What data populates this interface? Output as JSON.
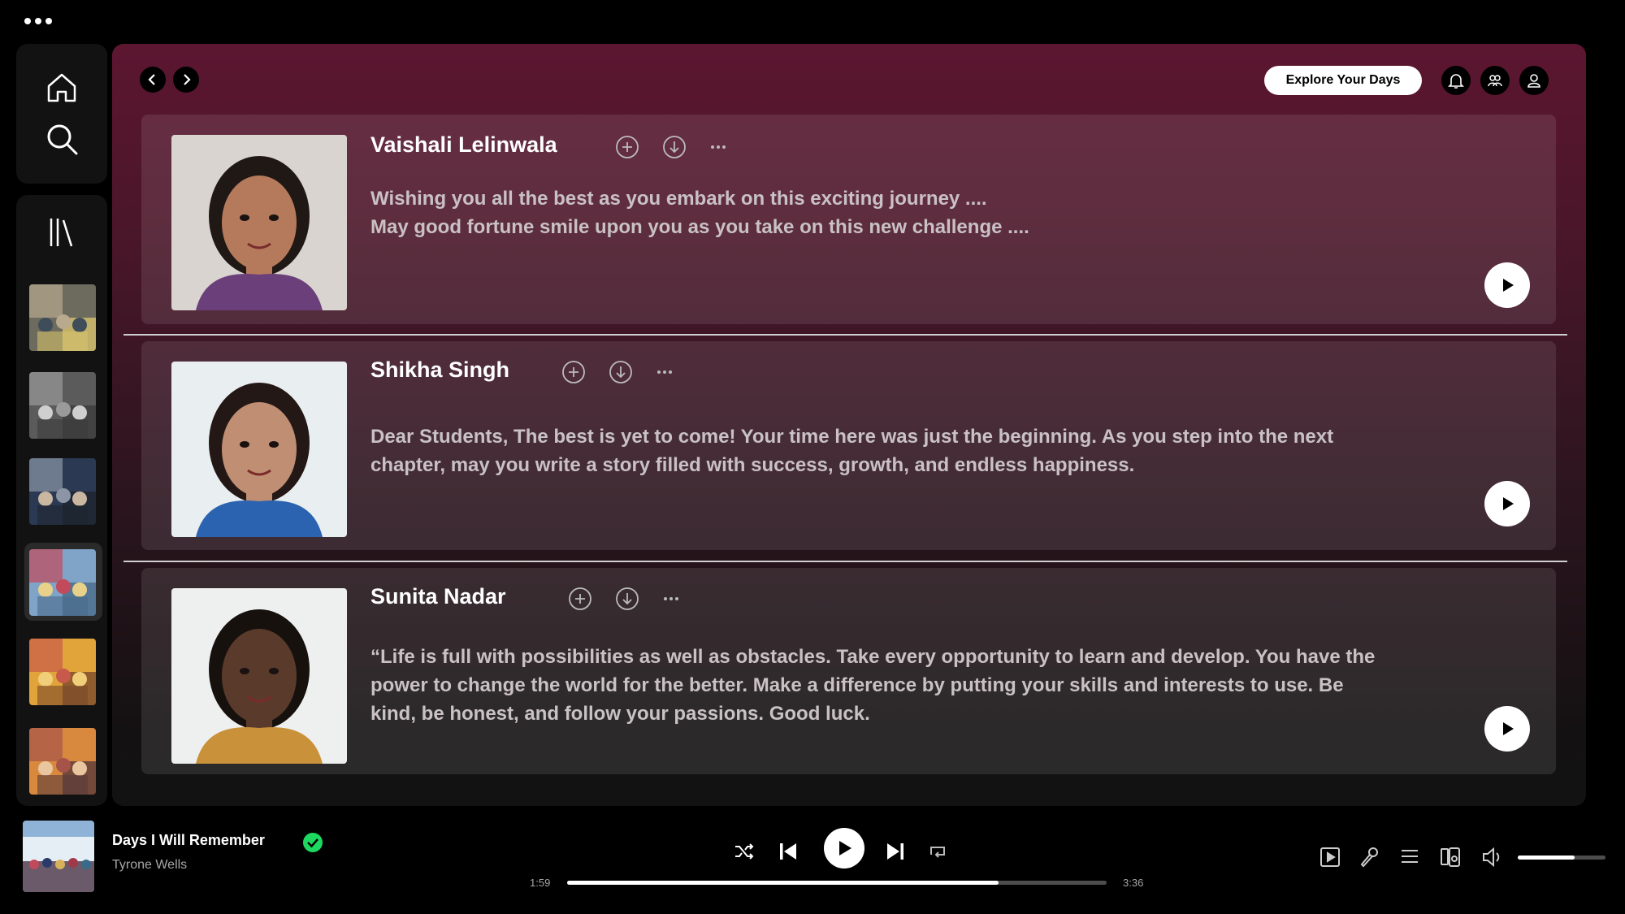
{
  "window": {
    "menu_icon": "more-dots-icon"
  },
  "sidebar": {
    "nav": [
      {
        "name": "home",
        "icon": "home-icon"
      },
      {
        "name": "search",
        "icon": "search-icon"
      }
    ],
    "library_icon": "library-icon",
    "playlists": [
      {
        "name": "playlist-1",
        "palette": [
          "#6d6a5e",
          "#b8a98f",
          "#3f4d5a",
          "#d6c26b"
        ]
      },
      {
        "name": "playlist-2",
        "palette": [
          "#5b5b5b",
          "#9a9a9a",
          "#cfcfcf",
          "#3c3c3c"
        ]
      },
      {
        "name": "playlist-3",
        "palette": [
          "#2b3a52",
          "#8c95a6",
          "#c9b7a2",
          "#1e2430"
        ]
      },
      {
        "name": "playlist-4",
        "palette": [
          "#7fa4c8",
          "#c24a5a",
          "#e8d28a",
          "#4a6c8c"
        ],
        "active": true
      },
      {
        "name": "playlist-5",
        "palette": [
          "#e0a43a",
          "#c75a4a",
          "#f1cf7a",
          "#7a4a2a"
        ]
      },
      {
        "name": "playlist-6",
        "palette": [
          "#d9893e",
          "#a6544a",
          "#e9c6a0",
          "#5a3a3a"
        ]
      }
    ]
  },
  "header": {
    "explore_label": "Explore Your Days",
    "icons": [
      "bell-icon",
      "friends-icon",
      "profile-icon"
    ]
  },
  "cards": [
    {
      "name": "Vaishali Lelinwala",
      "lines": [
        "Wishing you all the best as you embark on this exciting journey ....",
        "May good fortune smile upon you as you take on this new challenge ...."
      ],
      "photo_bg": "#d9d4cf",
      "skin": "#b57a5c",
      "hair": "#1f1814",
      "cloth": "#6a3f7a"
    },
    {
      "name": "Shikha Singh",
      "lines": [
        "Dear Students, The best is yet to come! Your time here was just the beginning. As you step into the next",
        "chapter, may you write a story filled with success, growth, and endless happiness."
      ],
      "photo_bg": "#e9eef0",
      "skin": "#c08e72",
      "hair": "#231815",
      "cloth": "#2c63b0"
    },
    {
      "name": "Sunita Nadar",
      "lines": [
        "“Life is full with possibilities as well as obstacles. Take every opportunity to learn and develop. You have the",
        "power to change the world for the better. Make a difference by putting your skills and interests to use. Be",
        "kind, be honest, and follow your passions. Good luck."
      ],
      "photo_bg": "#eef0f0",
      "skin": "#5a3a2b",
      "hair": "#17110e",
      "cloth": "#c9923a"
    }
  ],
  "card_icons": [
    "add-icon",
    "download-icon",
    "more-icon",
    "play-icon"
  ],
  "player": {
    "title": "Days I Will Remember",
    "artist": "Tyrone Wells",
    "saved_icon": "check-circle-icon",
    "elapsed": "1:59",
    "duration": "3:36",
    "progress": 0.8,
    "volume": 0.65,
    "controls": [
      "shuffle-icon",
      "previous-icon",
      "play-icon",
      "next-icon",
      "repeat-icon"
    ],
    "right_icons": [
      "now-playing-view-icon",
      "lyrics-icon",
      "queue-icon",
      "connect-device-icon",
      "volume-icon"
    ]
  }
}
